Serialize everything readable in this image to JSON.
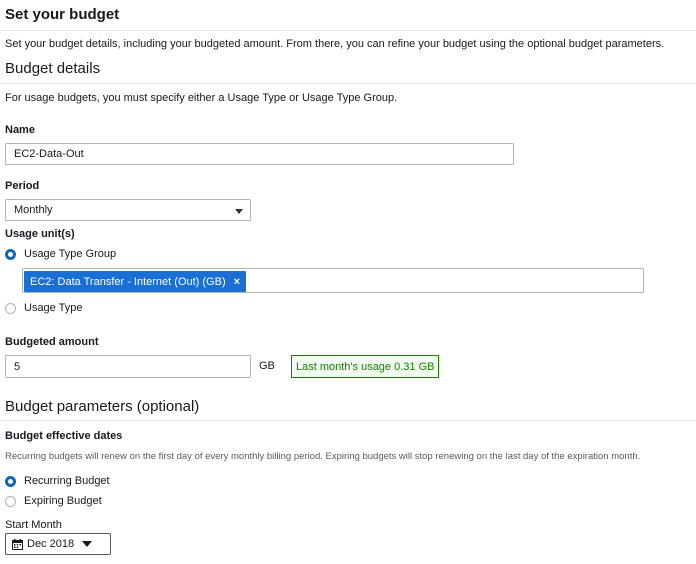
{
  "header": {
    "title": "Set your budget",
    "description": "Set your budget details, including your budgeted amount. From there, you can refine your budget using the optional budget parameters."
  },
  "budget_details": {
    "title": "Budget details",
    "note": "For usage budgets, you must specify either a Usage Type or Usage Type Group."
  },
  "name_field": {
    "label": "Name",
    "value": "EC2-Data-Out"
  },
  "period_field": {
    "label": "Period",
    "selected": "Monthly"
  },
  "usage_units": {
    "label": "Usage unit(s)",
    "options": [
      {
        "label": "Usage Type Group",
        "selected": true
      },
      {
        "label": "Usage Type",
        "selected": false
      }
    ],
    "selected_tag": "EC2: Data Transfer - Internet (Out) (GB)",
    "remove_glyph": "×"
  },
  "budgeted_amount": {
    "label": "Budgeted amount",
    "value": "5",
    "unit": "GB",
    "hint": "Last month's usage 0.31 GB"
  },
  "budget_parameters": {
    "title": "Budget parameters (optional)",
    "effective_dates_label": "Budget effective dates",
    "effective_dates_note": "Recurring budgets will renew on the first day of every monthly billing period. Expiring budgets will stop renewing on the last day of the expiration month.",
    "options": [
      {
        "label": "Recurring Budget",
        "selected": true
      },
      {
        "label": "Expiring Budget",
        "selected": false
      }
    ],
    "start_month_label": "Start Month",
    "start_month_value": "Dec 2018"
  },
  "colors": {
    "accent": "#1166bb",
    "tag_bg": "#1a6fd4",
    "success": "#1d8102",
    "border": "#aab7b8"
  },
  "icons": [
    "calendar-icon",
    "caret-down-icon",
    "close-icon"
  ]
}
